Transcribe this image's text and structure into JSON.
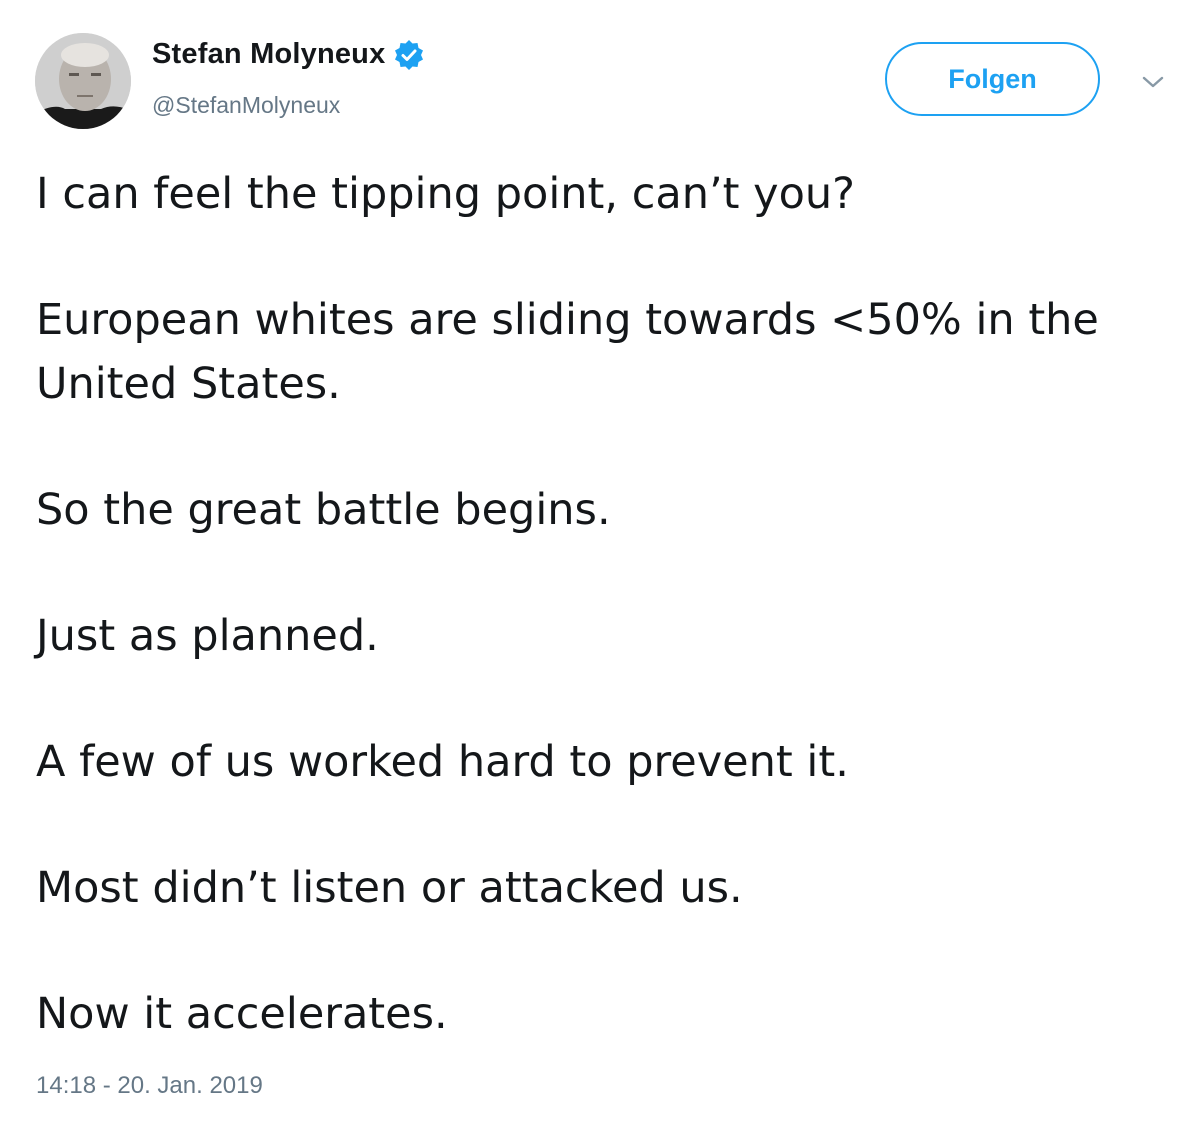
{
  "user": {
    "display_name": "Stefan Molyneux",
    "handle": "@StefanMolyneux",
    "verified": true
  },
  "actions": {
    "follow_label": "Folgen",
    "more_icon": "chevron-down-icon"
  },
  "tweet": {
    "paragraphs": [
      "I can feel the tipping point, can’t you?",
      "European whites are sliding towards <50% in the United States.",
      "So the great battle begins.",
      "Just as planned.",
      "A few of us worked hard to prevent it.",
      "Most didn’t listen or attacked us.",
      "Now it accelerates."
    ],
    "timestamp": "14:18 - 20. Jan. 2019"
  },
  "colors": {
    "accent": "#1da1f2",
    "text": "#14171a",
    "secondary_text": "#657786"
  }
}
